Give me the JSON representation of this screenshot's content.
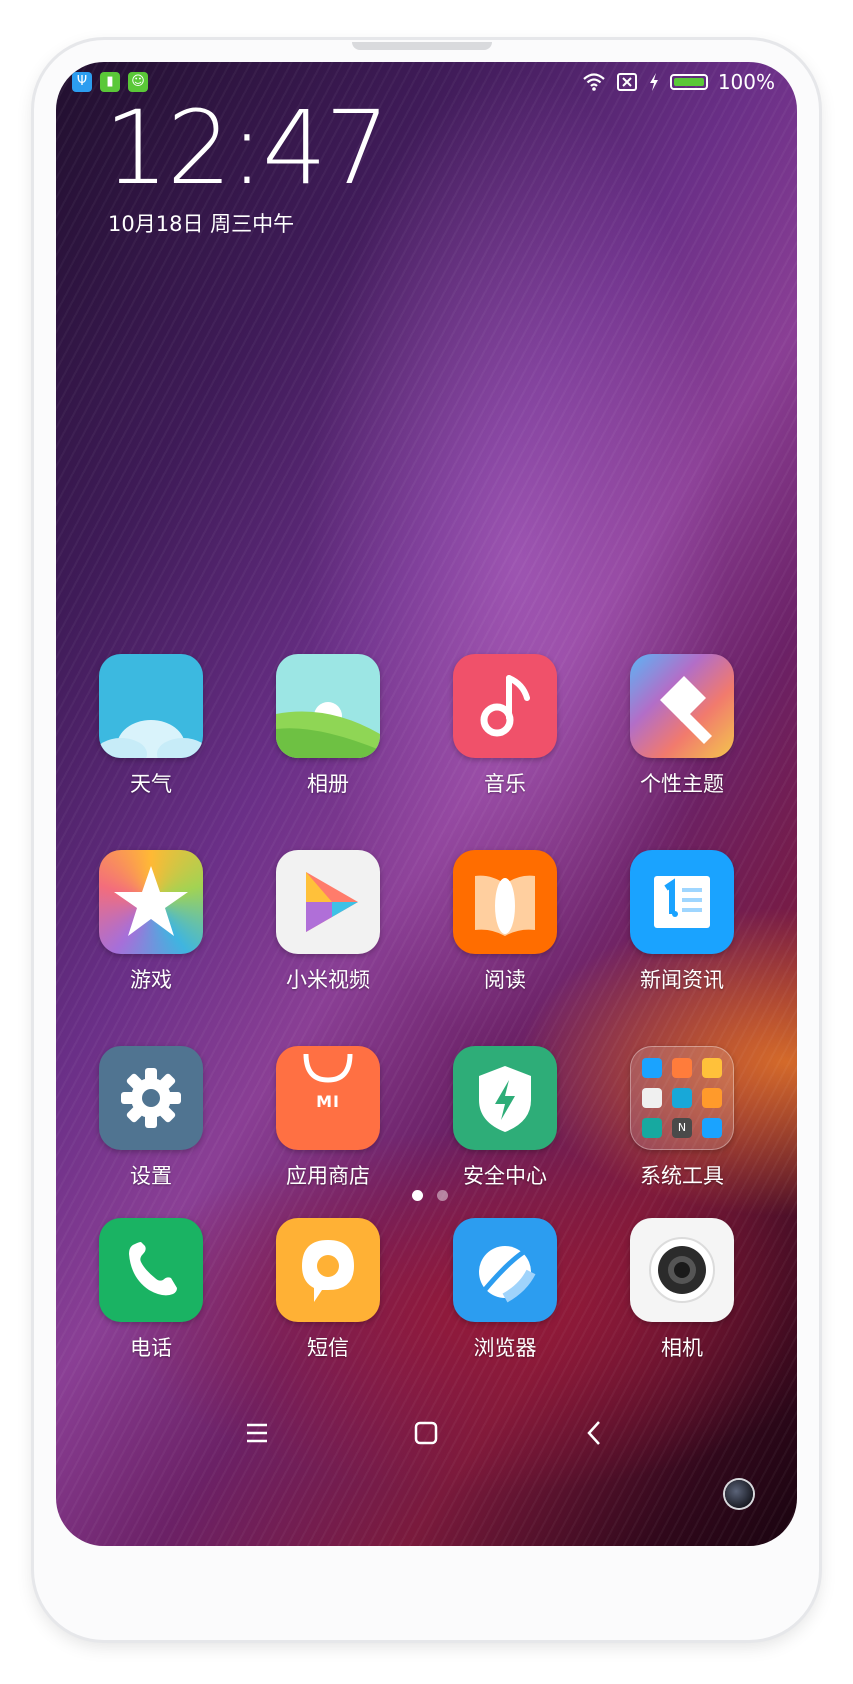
{
  "status_bar": {
    "left_icons": [
      "usb-icon",
      "sim-icon",
      "android-icon"
    ],
    "battery_text": "100%",
    "battery_level": 1.0
  },
  "lockclock": {
    "time": "12:47",
    "date": "10月18日 周三中午"
  },
  "apps": [
    {
      "label": "天气",
      "icon": "weather-icon"
    },
    {
      "label": "相册",
      "icon": "gallery-icon"
    },
    {
      "label": "音乐",
      "icon": "music-icon"
    },
    {
      "label": "个性主题",
      "icon": "themes-icon"
    },
    {
      "label": "游戏",
      "icon": "games-icon"
    },
    {
      "label": "小米视频",
      "icon": "video-icon"
    },
    {
      "label": "阅读",
      "icon": "reader-icon"
    },
    {
      "label": "新闻资讯",
      "icon": "news-icon"
    },
    {
      "label": "设置",
      "icon": "settings-icon"
    },
    {
      "label": "应用商店",
      "icon": "app-store-icon"
    },
    {
      "label": "安全中心",
      "icon": "security-icon"
    },
    {
      "label": "系统工具",
      "icon": "folder-icon"
    }
  ],
  "dock": [
    {
      "label": "电话",
      "icon": "phone-icon"
    },
    {
      "label": "短信",
      "icon": "messages-icon"
    },
    {
      "label": "浏览器",
      "icon": "browser-icon"
    },
    {
      "label": "相机",
      "icon": "camera-icon"
    }
  ],
  "page_indicator": {
    "pages": 2,
    "current": 1
  },
  "appstore_badge": "MI",
  "folder_letter": "N",
  "colors": {
    "weather": "#3cb9e0",
    "gallery": "#88d36b",
    "music": "#f0516a",
    "video": "#f2f2f2",
    "reader": "#ff6d00",
    "news": "#1aa3ff",
    "settings": "#507491",
    "app_store": "#ff7043",
    "security": "#2ead78",
    "phone": "#1ab363",
    "messages": "#ffb135",
    "browser": "#2c9df0",
    "camera": "#f5f5f5"
  }
}
